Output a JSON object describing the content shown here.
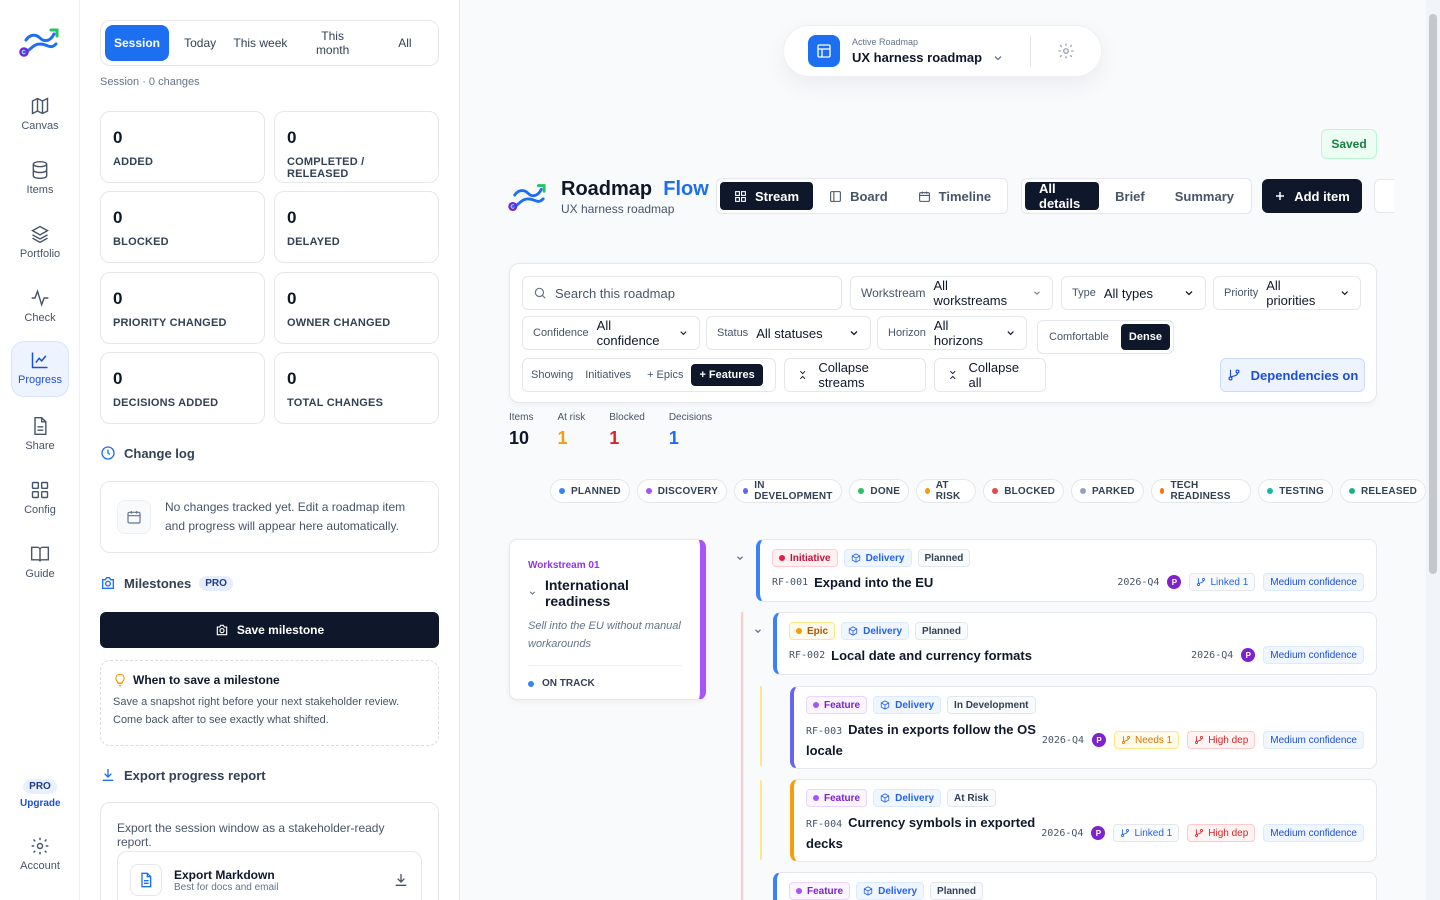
{
  "rail": {
    "items": [
      {
        "label": "Canvas",
        "icon": "map-icon"
      },
      {
        "label": "Items",
        "icon": "database-icon"
      },
      {
        "label": "Portfolio",
        "icon": "layers-icon"
      },
      {
        "label": "Check",
        "icon": "activity-icon"
      },
      {
        "label": "Progress",
        "icon": "chart-icon"
      },
      {
        "label": "Share",
        "icon": "document-icon"
      },
      {
        "label": "Config",
        "icon": "grid-icon"
      },
      {
        "label": "Guide",
        "icon": "book-icon"
      }
    ],
    "upgrade_badge": "PRO",
    "upgrade_label": "Upgrade",
    "account_label": "Account"
  },
  "progress": {
    "periods": [
      "Session",
      "Today",
      "This week",
      "This month",
      "All"
    ],
    "selected_period": "Session",
    "session_summary": "Session · 0 changes",
    "cards": [
      {
        "value": "0",
        "label": "ADDED"
      },
      {
        "value": "0",
        "label": "COMPLETED / RELEASED"
      },
      {
        "value": "0",
        "label": "BLOCKED"
      },
      {
        "value": "0",
        "label": "DELAYED"
      },
      {
        "value": "0",
        "label": "PRIORITY CHANGED"
      },
      {
        "value": "0",
        "label": "OWNER CHANGED"
      },
      {
        "value": "0",
        "label": "DECISIONS ADDED"
      },
      {
        "value": "0",
        "label": "TOTAL CHANGES"
      }
    ],
    "changelog_title": "Change log",
    "changelog_empty": "No changes tracked yet. Edit a roadmap item and progress will appear here automatically.",
    "milestones_title": "Milestones",
    "milestones_badge": "PRO",
    "save_milestone": "Save milestone",
    "tip_title": "When to save a milestone",
    "tip_body": "Save a snapshot right before your next stakeholder review. Come back after to see exactly what shifted.",
    "export_title": "Export progress report",
    "export_desc": "Export the session window as a stakeholder-ready report.",
    "export_md_title": "Export Markdown",
    "export_md_sub": "Best for docs and email"
  },
  "header": {
    "active_label": "Active Roadmap",
    "active_value": "UX harness roadmap",
    "saved": "Saved",
    "brand_a": "Roadmap",
    "brand_b": "Flow",
    "brand_sub": "UX harness roadmap",
    "views": [
      "Stream",
      "Board",
      "Timeline"
    ],
    "selected_view": "Stream",
    "detail_levels": [
      "All details",
      "Brief",
      "Summary"
    ],
    "selected_detail": "All details",
    "add_item": "Add item"
  },
  "filters": {
    "search_placeholder": "Search this roadmap",
    "workstream": {
      "key": "Workstream",
      "value": "All workstreams"
    },
    "type": {
      "key": "Type",
      "value": "All types"
    },
    "priority": {
      "key": "Priority",
      "value": "All priorities"
    },
    "confidence": {
      "key": "Confidence",
      "value": "All confidence"
    },
    "status": {
      "key": "Status",
      "value": "All statuses"
    },
    "horizon": {
      "key": "Horizon",
      "value": "All horizons"
    },
    "density": [
      "Comfortable",
      "Dense"
    ],
    "selected_density": "Dense",
    "showing_label": "Showing",
    "showing_options": [
      "Initiatives",
      "+ Epics",
      "+ Features"
    ],
    "selected_showing": "+ Features",
    "collapse_streams": "Collapse streams",
    "collapse_all": "Collapse all",
    "dependencies": "Dependencies on"
  },
  "stats": [
    {
      "label": "Items",
      "value": "10",
      "color": "#0f172a"
    },
    {
      "label": "At risk",
      "value": "1",
      "color": "#f59e0b"
    },
    {
      "label": "Blocked",
      "value": "1",
      "color": "#dc2626"
    },
    {
      "label": "Decisions",
      "value": "1",
      "color": "#1d6ff2"
    }
  ],
  "legend": [
    {
      "label": "PLANNED",
      "color": "#3b82f6"
    },
    {
      "label": "DISCOVERY",
      "color": "#a855f7"
    },
    {
      "label": "IN DEVELOPMENT",
      "color": "#6366f1"
    },
    {
      "label": "DONE",
      "color": "#22c55e"
    },
    {
      "label": "AT RISK",
      "color": "#f59e0b"
    },
    {
      "label": "BLOCKED",
      "color": "#ef4444"
    },
    {
      "label": "PARKED",
      "color": "#94a3b8"
    },
    {
      "label": "TECH READINESS",
      "color": "#f97316"
    },
    {
      "label": "TESTING",
      "color": "#14b8a6"
    },
    {
      "label": "RELEASED",
      "color": "#10b981"
    }
  ],
  "workstream": {
    "number": "Workstream 01",
    "title": "International readiness",
    "description": "Sell into the EU without manual workarounds",
    "status": "ON TRACK"
  },
  "items": [
    {
      "kind": "Initiative",
      "stream": "Delivery",
      "status": "Planned",
      "id": "RF-001",
      "title": "Expand into the EU",
      "quarter": "2026-Q4",
      "owner": "P",
      "needs": "",
      "linked": "Linked 1",
      "dep": "",
      "confidence": "Medium confidence"
    },
    {
      "kind": "Epic",
      "stream": "Delivery",
      "status": "Planned",
      "id": "RF-002",
      "title": "Local date and currency formats",
      "quarter": "2026-Q4",
      "owner": "P",
      "needs": "",
      "linked": "",
      "dep": "",
      "confidence": "Medium confidence"
    },
    {
      "kind": "Feature",
      "stream": "Delivery",
      "status": "In Development",
      "id": "RF-003",
      "title": "Dates in exports follow the OS locale",
      "quarter": "2026-Q4",
      "owner": "P",
      "needs": "Needs 1",
      "linked": "",
      "dep": "High dep",
      "confidence": "Medium confidence"
    },
    {
      "kind": "Feature",
      "stream": "Delivery",
      "status": "At Risk",
      "id": "RF-004",
      "title": "Currency symbols in exported decks",
      "quarter": "2026-Q4",
      "owner": "P",
      "needs": "",
      "linked": "Linked 1",
      "dep": "High dep",
      "confidence": "Medium confidence"
    },
    {
      "kind": "Feature",
      "stream": "Delivery",
      "status": "Planned"
    }
  ]
}
